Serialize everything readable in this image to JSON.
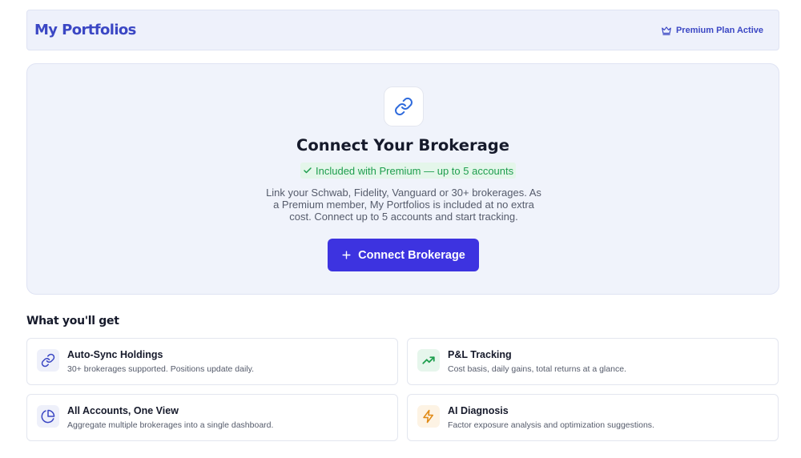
{
  "header": {
    "title": "My Portfolios",
    "plan_badge": "Premium Plan Active"
  },
  "hero": {
    "icon": "link-icon",
    "title": "Connect Your Brokerage",
    "included_badge": "Included with Premium — up to 5 accounts",
    "description": "Link your Schwab, Fidelity, Vanguard or 30+ brokerages. As a Premium member, My Portfolios is included at no extra cost. Connect up to 5 accounts and start tracking.",
    "button_label": "Connect Brokerage"
  },
  "benefits": {
    "title": "What you'll get",
    "items": [
      {
        "icon": "link-icon",
        "title": "Auto-Sync Holdings",
        "description": "30+ brokerages supported. Positions update daily.",
        "color": "#3b47c4",
        "bg": "#eef0fa"
      },
      {
        "icon": "trending-up-icon",
        "title": "P&L Tracking",
        "description": "Cost basis, daily gains, total returns at a glance.",
        "color": "#1e9e4e",
        "bg": "#e6f6ec"
      },
      {
        "icon": "pie-chart-icon",
        "title": "All Accounts, One View",
        "description": "Aggregate multiple brokerages into a single dashboard.",
        "color": "#3b47c4",
        "bg": "#eef0fa"
      },
      {
        "icon": "lightning-icon",
        "title": "AI Diagnosis",
        "description": "Factor exposure analysis and optimization suggestions.",
        "color": "#e08a16",
        "bg": "#fdf3e4"
      }
    ]
  },
  "colors": {
    "brand": "#3b47c4",
    "primary_button": "#3d33e0",
    "success": "#1e9e4e",
    "warning": "#e08a16"
  }
}
